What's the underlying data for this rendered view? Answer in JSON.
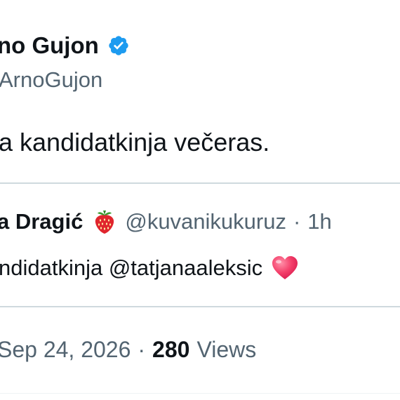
{
  "tweet": {
    "author_name": "no Gujon",
    "author_handle": "ArnoGujon",
    "text": "a kandidatkinja večeras."
  },
  "quoted": {
    "author_name": "a Dragić",
    "author_handle": "@kuvanikukuruz",
    "separator": "·",
    "time": "1h",
    "text": "ndidatkinja @tatjanaaleksic"
  },
  "meta": {
    "date": "Sep 24, 2026",
    "separator": "·",
    "views_count": "280",
    "views_label": "Views"
  },
  "colors": {
    "primary_text": "#0f1419",
    "secondary_text": "#536471",
    "verified_badge": "#1d9bf0",
    "divider": "#cfd9de"
  },
  "icons": [
    "verified-badge-icon",
    "strawberry-emoji-icon",
    "heart-emoji-icon"
  ]
}
